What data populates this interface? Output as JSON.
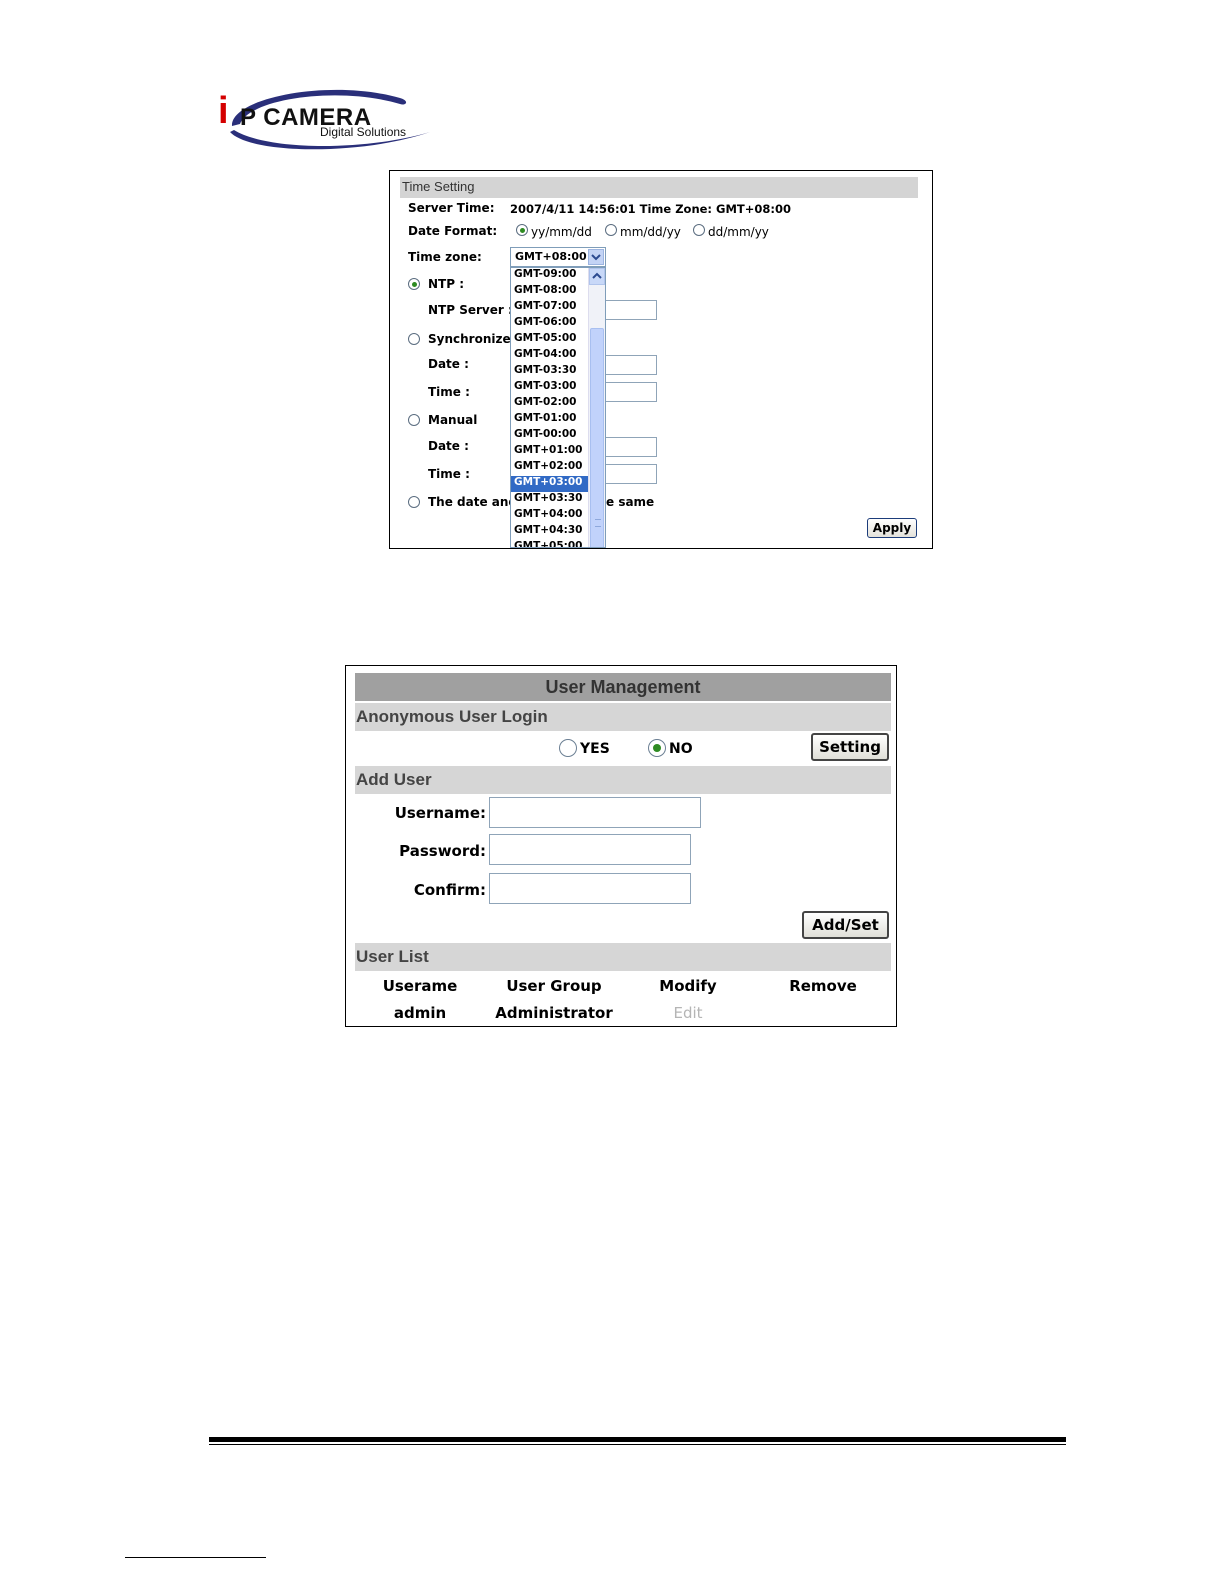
{
  "logo": {
    "letter_i": "i",
    "main": "P CAMERA",
    "sub": "Digital Solutions"
  },
  "time_setting": {
    "title": "Time Setting",
    "server_time_label": "Server Time:",
    "server_time_value": "2007/4/11 14:56:01 Time Zone: GMT+08:00",
    "date_format_label": "Date Format:",
    "date_formats": [
      {
        "label": "yy/mm/dd",
        "selected": true
      },
      {
        "label": "mm/dd/yy",
        "selected": false
      },
      {
        "label": "dd/mm/yy",
        "selected": false
      }
    ],
    "time_zone_label": "Time zone:",
    "time_zone_value": "GMT+08:00",
    "time_zone_options": [
      "GMT-09:00",
      "GMT-08:00",
      "GMT-07:00",
      "GMT-06:00",
      "GMT-05:00",
      "GMT-04:00",
      "GMT-03:30",
      "GMT-03:00",
      "GMT-02:00",
      "GMT-01:00",
      "GMT-00:00",
      "GMT+01:00",
      "GMT+02:00",
      "GMT+03:00",
      "GMT+03:30",
      "GMT+04:00",
      "GMT+04:30",
      "GMT+05:00"
    ],
    "highlighted_option": "GMT+03:00",
    "ntp_label": "NTP :",
    "ntp_server_label": "NTP Server :",
    "sync_label": "Synchronize",
    "sync_date_label": "Date :",
    "sync_time_label": "Time :",
    "manual_label": "Manual",
    "manual_date_label": "Date :",
    "manual_time_label": "Time :",
    "same_label_left": "The date and",
    "same_label_right": "e same",
    "apply_label": "Apply"
  },
  "user_management": {
    "title": "User Management",
    "anon_section": "Anonymous User Login",
    "yes_label": "YES",
    "no_label": "NO",
    "anon_selected": "NO",
    "setting_label": "Setting",
    "add_section": "Add User",
    "username_label": "Username:",
    "password_label": "Password:",
    "confirm_label": "Confirm:",
    "addset_label": "Add/Set",
    "list_section": "User List",
    "columns": [
      "Userame",
      "User Group",
      "Modify",
      "Remove"
    ],
    "rows": [
      {
        "username": "admin",
        "group": "Administrator",
        "modify": "Edit",
        "remove": ""
      }
    ]
  }
}
